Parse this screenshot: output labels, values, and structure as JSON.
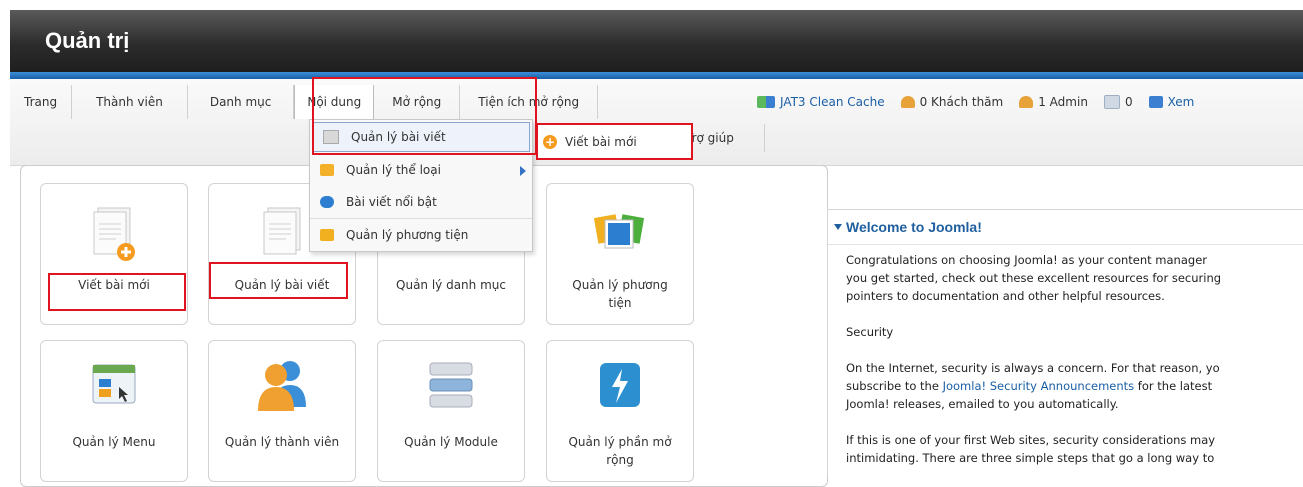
{
  "header": {
    "title": "Quản trị"
  },
  "menu": [
    {
      "label": "Trang"
    },
    {
      "label": "Thành viên"
    },
    {
      "label": "Danh mục"
    },
    {
      "label": "Nội dung"
    },
    {
      "label": "Mở rộng"
    },
    {
      "label": "Tiện ích mở rộng"
    }
  ],
  "submenu": {
    "help": "Trợ giúp"
  },
  "status": {
    "cache": "JAT3 Clean Cache",
    "guests": "0 Khách thăm",
    "admins": "1 Admin",
    "messages": "0",
    "view": "Xem"
  },
  "dropdown": [
    {
      "label": "Quản lý bài viết",
      "icon": "folder-icon"
    },
    {
      "label": "Quản lý thể loại",
      "icon": "category-folder-icon",
      "has_submenu": true
    },
    {
      "label": "Bài viết nổi bật",
      "icon": "star-icon"
    },
    {
      "label": "Quản lý phương tiện",
      "icon": "media-icon"
    }
  ],
  "flyout": {
    "label": "Viết bài mới",
    "icon": "add-icon"
  },
  "tiles": [
    {
      "label": "Viết bài mới",
      "icon": "new-article-icon"
    },
    {
      "label": "Quản lý bài viết",
      "icon": "article-icon"
    },
    {
      "label": "Quản lý danh mục",
      "icon": "category-icon"
    },
    {
      "label": "Quản lý phương tiện",
      "icon": "media-manager-icon"
    },
    {
      "label": "Quản lý Menu",
      "icon": "menu-icon"
    },
    {
      "label": "Quản lý thành viên",
      "icon": "users-icon"
    },
    {
      "label": "Quản lý Module",
      "icon": "module-icon"
    },
    {
      "label": "Quản lý phần mở rộng",
      "icon": "extension-icon"
    }
  ],
  "welcome": {
    "title": "Welcome to Joomla!",
    "p1_l1": "Congratulations on choosing Joomla! as your content manager",
    "p1_l2": "you get started, check out these excellent resources for securing",
    "p1_l3": "pointers to documentation and other helpful resources.",
    "security": "Security",
    "p2_l1": "On the Internet, security is always a concern. For that reason, yo",
    "p2_l2a": "subscribe to the ",
    "p2_link": "Joomla! Security Announcements",
    "p2_l2b": " for the latest",
    "p2_l3": "Joomla! releases, emailed to you automatically.",
    "p3_l1": "If this is one of your first Web sites, security considerations may",
    "p3_l2": "intimidating. There are three simple steps that go a long way to"
  },
  "colors": {
    "accent": "#1a5fa6",
    "highlight": "#e0141e",
    "header_bg": "#2c2c2c"
  }
}
